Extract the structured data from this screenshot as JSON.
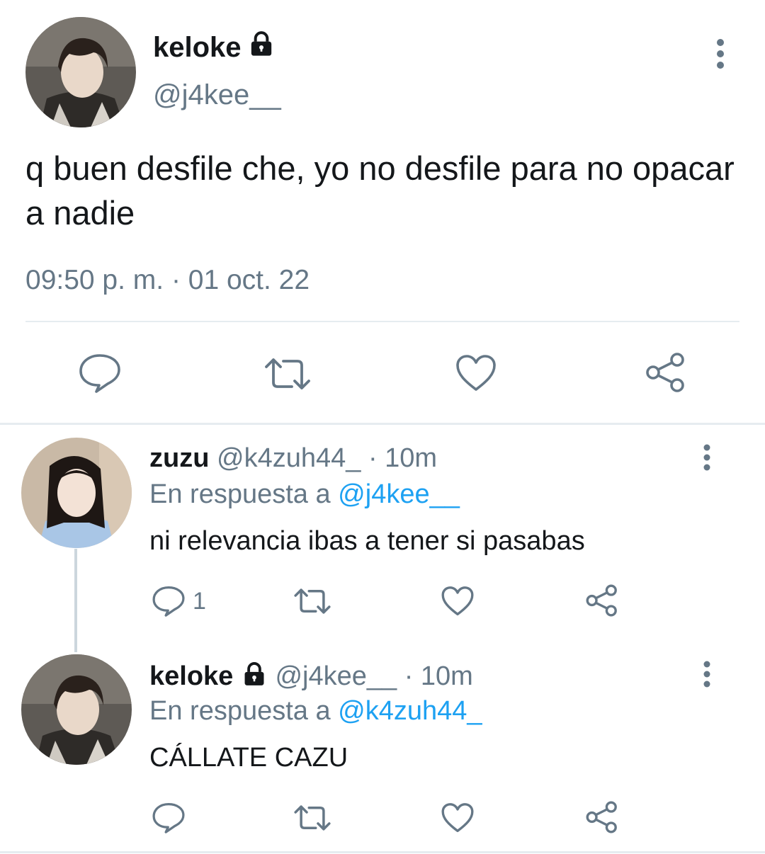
{
  "main_tweet": {
    "name": "keloke",
    "handle": "@j4kee__",
    "text": "q buen desfile che, yo no desfile para no opacar a nadie",
    "timestamp": "09:50 p. m. · 01 oct. 22",
    "icons": [
      "lock-icon",
      "more-vertical-icon",
      "reply-icon",
      "retweet-icon",
      "like-icon",
      "share-icon"
    ]
  },
  "replies": [
    {
      "name": "zuzu",
      "handle": "@k4zuh44_",
      "time": "· 10m",
      "reply_prefix": "En respuesta a",
      "reply_to": "@j4kee__",
      "text": "ni relevancia ibas a tener si pasabas",
      "reply_count": "1"
    },
    {
      "name": "keloke",
      "handle": "@j4kee__",
      "time": "· 10m",
      "reply_prefix": "En respuesta a",
      "reply_to": "@k4zuh44_",
      "text": "CÁLLATE CAZU",
      "reply_count": ""
    }
  ],
  "colors": {
    "text": "#14171a",
    "secondary": "#657786",
    "link": "#1da1f2",
    "divider": "#e6ecf0",
    "thread_line": "#ccd6dd"
  }
}
